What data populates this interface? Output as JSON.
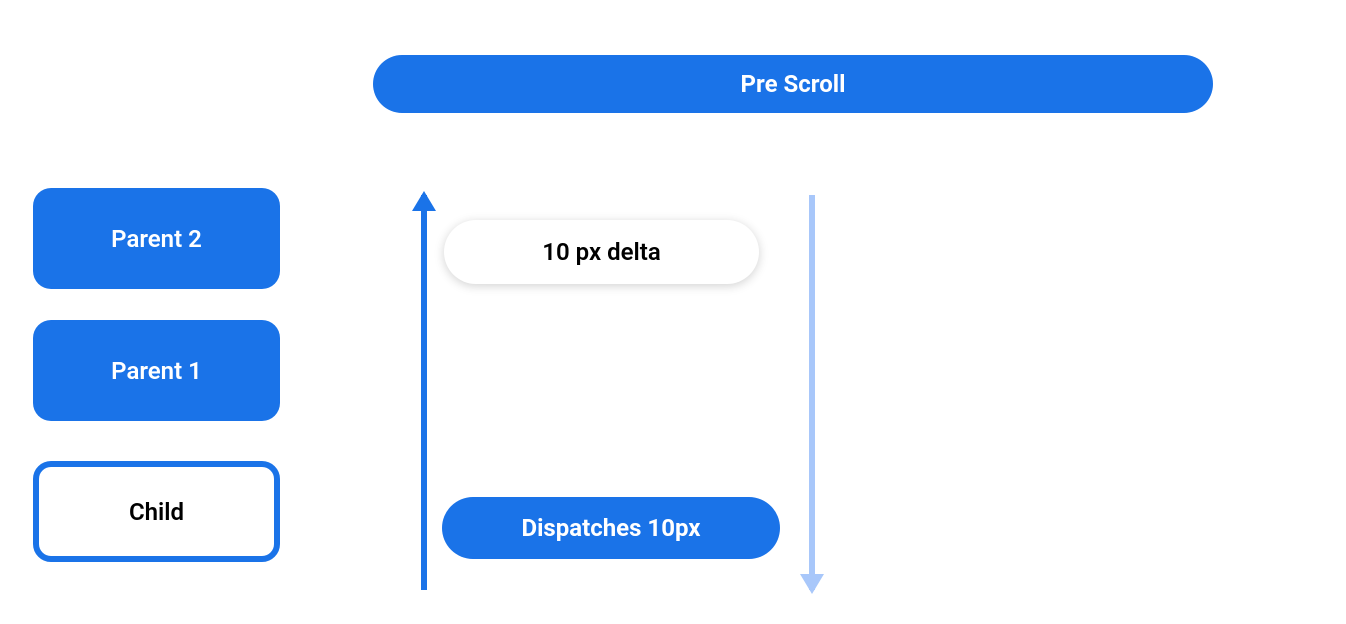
{
  "title": "Pre Scroll",
  "blocks": {
    "parent2": "Parent 2",
    "parent1": "Parent 1",
    "child": "Child"
  },
  "delta": "10 px delta",
  "dispatch": "Dispatches 10px",
  "colors": {
    "primary": "#1a73e8",
    "arrow_light": "#a8c7fa"
  }
}
